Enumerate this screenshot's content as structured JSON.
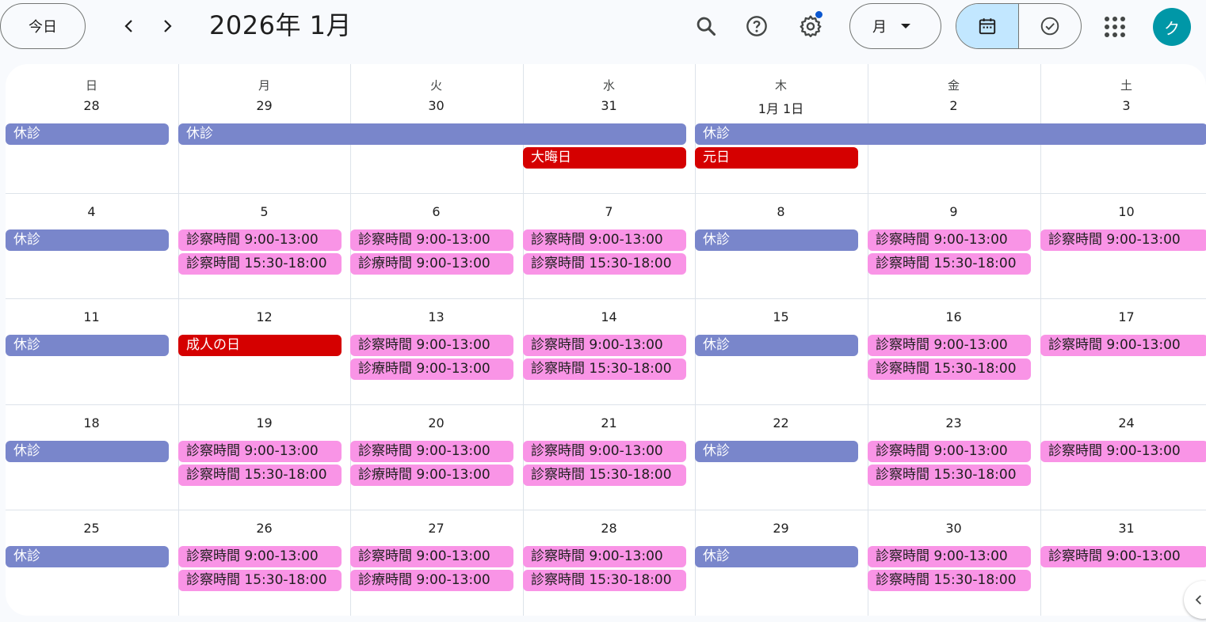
{
  "toolbar": {
    "today_label": "今日",
    "month_title": "2026年 1月",
    "view_label": "月",
    "avatar_initial": "ク",
    "icons": [
      "chevron-left-icon",
      "chevron-right-icon",
      "search-icon",
      "help-icon",
      "settings-icon",
      "caret-down-icon",
      "calendar-icon",
      "tasks-check-icon",
      "apps-grid-icon"
    ],
    "settings_has_notification": true
  },
  "calendar": {
    "weekdays": [
      "日",
      "月",
      "火",
      "水",
      "木",
      "金",
      "土"
    ],
    "weeks": [
      [
        "28",
        "29",
        "30",
        "31",
        "1月 1日",
        "2",
        "3"
      ],
      [
        "4",
        "5",
        "6",
        "7",
        "8",
        "9",
        "10"
      ],
      [
        "11",
        "12",
        "13",
        "14",
        "15",
        "16",
        "17"
      ],
      [
        "18",
        "19",
        "20",
        "21",
        "22",
        "23",
        "24"
      ],
      [
        "25",
        "26",
        "27",
        "28",
        "29",
        "30",
        "31"
      ]
    ],
    "events": [
      {
        "week": 0,
        "start": 0,
        "span": 1,
        "row": 0,
        "kind": "off",
        "title": "休診"
      },
      {
        "week": 0,
        "start": 1,
        "span": 3,
        "row": 0,
        "kind": "off",
        "title": "休診"
      },
      {
        "week": 0,
        "start": 4,
        "span": 3,
        "row": 0,
        "kind": "off",
        "title": "休診"
      },
      {
        "week": 0,
        "start": 3,
        "span": 1,
        "row": 1,
        "kind": "hol",
        "title": "大晦日"
      },
      {
        "week": 0,
        "start": 4,
        "span": 1,
        "row": 1,
        "kind": "hol",
        "title": "元日"
      },
      {
        "week": 1,
        "start": 0,
        "span": 1,
        "row": 0,
        "kind": "off",
        "title": "休診"
      },
      {
        "week": 1,
        "start": 1,
        "span": 1,
        "row": 0,
        "kind": "clin",
        "title": "診察時間 9:00-13:00"
      },
      {
        "week": 1,
        "start": 1,
        "span": 1,
        "row": 1,
        "kind": "clin",
        "title": "診察時間 15:30-18:00"
      },
      {
        "week": 1,
        "start": 2,
        "span": 1,
        "row": 0,
        "kind": "clin",
        "title": "診察時間 9:00-13:00"
      },
      {
        "week": 1,
        "start": 2,
        "span": 1,
        "row": 1,
        "kind": "clin",
        "title": "診療時間 9:00-13:00"
      },
      {
        "week": 1,
        "start": 3,
        "span": 1,
        "row": 0,
        "kind": "clin",
        "title": "診察時間 9:00-13:00"
      },
      {
        "week": 1,
        "start": 3,
        "span": 1,
        "row": 1,
        "kind": "clin",
        "title": "診察時間 15:30-18:00"
      },
      {
        "week": 1,
        "start": 4,
        "span": 1,
        "row": 0,
        "kind": "off",
        "title": "休診"
      },
      {
        "week": 1,
        "start": 5,
        "span": 1,
        "row": 0,
        "kind": "clin",
        "title": "診察時間 9:00-13:00"
      },
      {
        "week": 1,
        "start": 5,
        "span": 1,
        "row": 1,
        "kind": "clin",
        "title": "診察時間 15:30-18:00"
      },
      {
        "week": 1,
        "start": 6,
        "span": 1,
        "row": 0,
        "kind": "clin",
        "title": "診察時間 9:00-13:00"
      },
      {
        "week": 2,
        "start": 0,
        "span": 1,
        "row": 0,
        "kind": "off",
        "title": "休診"
      },
      {
        "week": 2,
        "start": 1,
        "span": 1,
        "row": 0,
        "kind": "hol",
        "title": "成人の日"
      },
      {
        "week": 2,
        "start": 2,
        "span": 1,
        "row": 0,
        "kind": "clin",
        "title": "診察時間 9:00-13:00"
      },
      {
        "week": 2,
        "start": 2,
        "span": 1,
        "row": 1,
        "kind": "clin",
        "title": "診療時間 9:00-13:00"
      },
      {
        "week": 2,
        "start": 3,
        "span": 1,
        "row": 0,
        "kind": "clin",
        "title": "診察時間 9:00-13:00"
      },
      {
        "week": 2,
        "start": 3,
        "span": 1,
        "row": 1,
        "kind": "clin",
        "title": "診察時間 15:30-18:00"
      },
      {
        "week": 2,
        "start": 4,
        "span": 1,
        "row": 0,
        "kind": "off",
        "title": "休診"
      },
      {
        "week": 2,
        "start": 5,
        "span": 1,
        "row": 0,
        "kind": "clin",
        "title": "診察時間 9:00-13:00"
      },
      {
        "week": 2,
        "start": 5,
        "span": 1,
        "row": 1,
        "kind": "clin",
        "title": "診察時間 15:30-18:00"
      },
      {
        "week": 2,
        "start": 6,
        "span": 1,
        "row": 0,
        "kind": "clin",
        "title": "診察時間 9:00-13:00"
      },
      {
        "week": 3,
        "start": 0,
        "span": 1,
        "row": 0,
        "kind": "off",
        "title": "休診"
      },
      {
        "week": 3,
        "start": 1,
        "span": 1,
        "row": 0,
        "kind": "clin",
        "title": "診察時間 9:00-13:00"
      },
      {
        "week": 3,
        "start": 1,
        "span": 1,
        "row": 1,
        "kind": "clin",
        "title": "診察時間 15:30-18:00"
      },
      {
        "week": 3,
        "start": 2,
        "span": 1,
        "row": 0,
        "kind": "clin",
        "title": "診察時間 9:00-13:00"
      },
      {
        "week": 3,
        "start": 2,
        "span": 1,
        "row": 1,
        "kind": "clin",
        "title": "診療時間 9:00-13:00"
      },
      {
        "week": 3,
        "start": 3,
        "span": 1,
        "row": 0,
        "kind": "clin",
        "title": "診察時間 9:00-13:00"
      },
      {
        "week": 3,
        "start": 3,
        "span": 1,
        "row": 1,
        "kind": "clin",
        "title": "診察時間 15:30-18:00"
      },
      {
        "week": 3,
        "start": 4,
        "span": 1,
        "row": 0,
        "kind": "off",
        "title": "休診"
      },
      {
        "week": 3,
        "start": 5,
        "span": 1,
        "row": 0,
        "kind": "clin",
        "title": "診察時間 9:00-13:00"
      },
      {
        "week": 3,
        "start": 5,
        "span": 1,
        "row": 1,
        "kind": "clin",
        "title": "診察時間 15:30-18:00"
      },
      {
        "week": 3,
        "start": 6,
        "span": 1,
        "row": 0,
        "kind": "clin",
        "title": "診察時間 9:00-13:00"
      },
      {
        "week": 4,
        "start": 0,
        "span": 1,
        "row": 0,
        "kind": "off",
        "title": "休診"
      },
      {
        "week": 4,
        "start": 1,
        "span": 1,
        "row": 0,
        "kind": "clin",
        "title": "診察時間 9:00-13:00"
      },
      {
        "week": 4,
        "start": 1,
        "span": 1,
        "row": 1,
        "kind": "clin",
        "title": "診察時間 15:30-18:00"
      },
      {
        "week": 4,
        "start": 2,
        "span": 1,
        "row": 0,
        "kind": "clin",
        "title": "診察時間 9:00-13:00"
      },
      {
        "week": 4,
        "start": 2,
        "span": 1,
        "row": 1,
        "kind": "clin",
        "title": "診療時間 9:00-13:00"
      },
      {
        "week": 4,
        "start": 3,
        "span": 1,
        "row": 0,
        "kind": "clin",
        "title": "診察時間 9:00-13:00"
      },
      {
        "week": 4,
        "start": 3,
        "span": 1,
        "row": 1,
        "kind": "clin",
        "title": "診察時間 15:30-18:00"
      },
      {
        "week": 4,
        "start": 4,
        "span": 1,
        "row": 0,
        "kind": "off",
        "title": "休診"
      },
      {
        "week": 4,
        "start": 5,
        "span": 1,
        "row": 0,
        "kind": "clin",
        "title": "診察時間 9:00-13:00"
      },
      {
        "week": 4,
        "start": 5,
        "span": 1,
        "row": 1,
        "kind": "clin",
        "title": "診察時間 15:30-18:00"
      },
      {
        "week": 4,
        "start": 6,
        "span": 1,
        "row": 0,
        "kind": "clin",
        "title": "診察時間 9:00-13:00"
      }
    ]
  },
  "colors": {
    "off_day": "#7986cb",
    "holiday": "#d50000",
    "clinic_hours": "#f994e6",
    "active_view": "#c2e7ff",
    "avatar_bg": "#0097a7",
    "notification_dot": "#0b57d0"
  }
}
